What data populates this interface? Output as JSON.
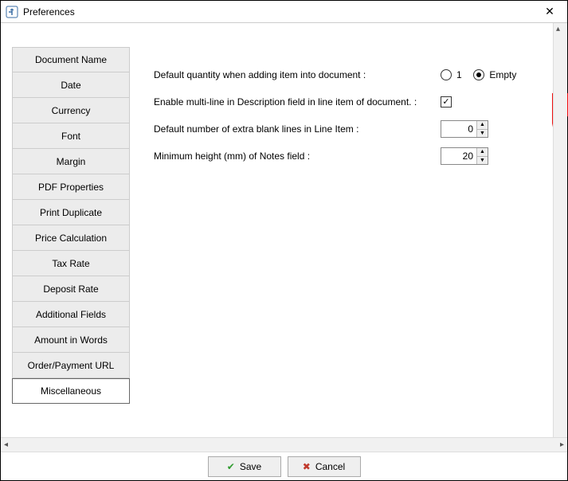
{
  "window": {
    "title": "Preferences"
  },
  "sidebar": {
    "items": [
      {
        "label": "Document Name"
      },
      {
        "label": "Date"
      },
      {
        "label": "Currency"
      },
      {
        "label": "Font"
      },
      {
        "label": "Margin"
      },
      {
        "label": "PDF Properties"
      },
      {
        "label": "Print Duplicate"
      },
      {
        "label": "Price Calculation"
      },
      {
        "label": "Tax Rate"
      },
      {
        "label": "Deposit Rate"
      },
      {
        "label": "Additional Fields"
      },
      {
        "label": "Amount in Words"
      },
      {
        "label": "Order/Payment URL"
      },
      {
        "label": "Miscellaneous"
      }
    ],
    "selected_index": 13
  },
  "form": {
    "default_quantity_label": "Default quantity when adding item into document :",
    "default_quantity_options": {
      "opt1": "1",
      "opt2": "Empty"
    },
    "default_quantity_value": "Empty",
    "multiline_label": "Enable multi-line in Description field in line item of document. :",
    "multiline_checked": true,
    "blank_lines_label": "Default number of extra blank lines in Line Item :",
    "blank_lines_value": "0",
    "notes_height_label": "Minimum height (mm) of Notes field :",
    "notes_height_value": "20"
  },
  "footer": {
    "save_label": "Save",
    "cancel_label": "Cancel"
  }
}
